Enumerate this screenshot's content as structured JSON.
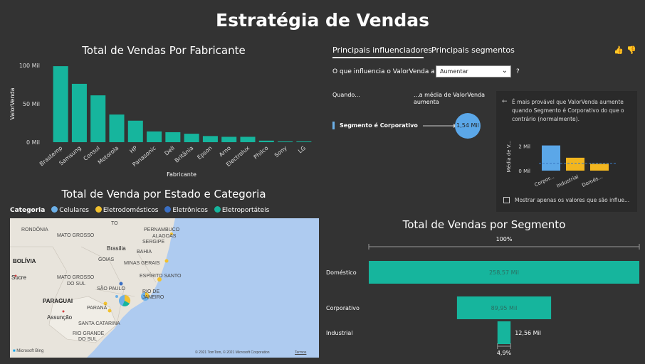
{
  "page_title": "Estratégia de Vendas",
  "chart_data": [
    {
      "type": "bar",
      "title": "Total de Vendas Por Fabricante",
      "xlabel": "Fabricante",
      "ylabel": "ValorVenda",
      "categories": [
        "Brastemp",
        "Samsung",
        "Consul",
        "Motorola",
        "HP",
        "Panasonic",
        "Dell",
        "Britânia",
        "Epson",
        "Arno",
        "Electrolux",
        "Philco",
        "Sony",
        "LG"
      ],
      "values": [
        99,
        76,
        61,
        36,
        28,
        14,
        13,
        11,
        8,
        7,
        7,
        2,
        1,
        1
      ],
      "ytick_labels": [
        "0 Mil",
        "50 Mil",
        "100 Mil"
      ],
      "ylim": [
        0,
        100
      ],
      "color": "#16b59d"
    },
    {
      "type": "bar",
      "title": "Total de Vendas por Segmento",
      "orientation": "funnel",
      "categories": [
        "Doméstico",
        "Corporativo",
        "Industrial"
      ],
      "values": [
        258.57,
        89.95,
        12.56
      ],
      "data_labels": [
        "258,57 Mil",
        "89,95 Mil",
        "12,56 Mil"
      ],
      "top_label": "100%",
      "bottom_label": "4,9%",
      "color": "#16b59d"
    }
  ],
  "map": {
    "title": "Total de Venda por Estado e Categoria",
    "legend_title": "Categoria",
    "legend": [
      {
        "label": "Celulares",
        "color": "#6cb0e8"
      },
      {
        "label": "Eletrodomésticos",
        "color": "#f2c12e"
      },
      {
        "label": "Eletrônicos",
        "color": "#3a6fc4"
      },
      {
        "label": "Eletroportáteis",
        "color": "#16b59d"
      }
    ],
    "labels": {
      "rondonia": "RONDÔNIA",
      "mato_grosso": "MATO GROSSO",
      "to": "TO",
      "pernambuco": "PERNAMBUCO",
      "alagoas": "ALAGOAS",
      "sergipe": "SERGIPE",
      "brasilia": "Brasília",
      "goias": "GOIAS",
      "bahia": "BAHIA",
      "bolivia": "BOLÍVIA",
      "sucre": "Sucre",
      "mgs": "MATO GROSSO",
      "mgs2": "DO SUL",
      "minas": "MINAS GERAIS",
      "es": "ESPÍRITO SANTO",
      "sao_paulo": "SÃO PAULO",
      "rio": "RIO DE",
      "rio2": "JANEIRO",
      "paraguai": "PARAGUAI",
      "parana": "PARANÁ",
      "assuncao": "Assunção",
      "sc": "SANTA CATARINA",
      "rgs": "RIO GRANDE",
      "rgs2": "DO SUL",
      "bing": "Microsoft Bing",
      "copyright": "© 2021 TomTom, © 2021 Microsoft Corporation",
      "terms": "Termos"
    }
  },
  "influencers": {
    "tab_active": "Principais influenciadores",
    "tab_other": "Principais segmentos",
    "question_prefix": "O que influencia o ValorVenda a",
    "dropdown_value": "Aumentar",
    "help": "?",
    "col_when": "Quando...",
    "col_avg_1": "...a média de ValorVenda",
    "col_avg_2": "aumenta",
    "factor": "Segmento é Corporativo",
    "bubble": "1,54 Mil",
    "panel_text": "É mais provável que ValorVenda aumente quando Segmento é Corporativo do que o contrário (normalmente).",
    "panel_ylabel": "Média de V...",
    "panel_yticks": [
      "2 Mil",
      "0 Mil"
    ],
    "panel_bars": [
      {
        "label": "Corpor...",
        "value": 2.05,
        "color": "#5ba7e8"
      },
      {
        "label": "Industrial",
        "value": 1.05,
        "color": "#f2b61f"
      },
      {
        "label": "Domés...",
        "value": 0.55,
        "color": "#f2b61f"
      }
    ],
    "panel_avg": 0.6,
    "checkbox_label": "Mostrar apenas os valores que são influe..."
  }
}
